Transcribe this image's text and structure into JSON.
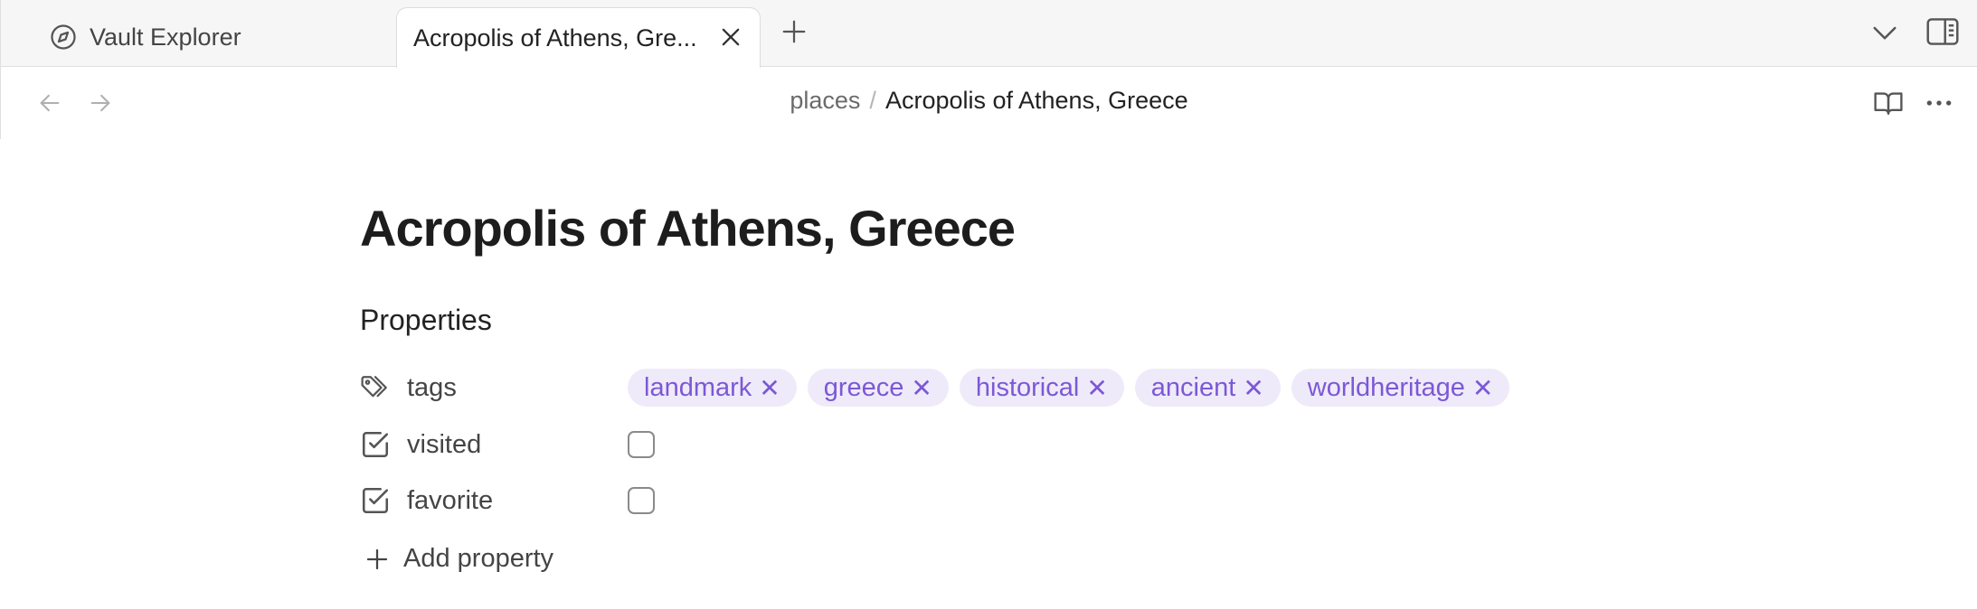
{
  "tabs": [
    {
      "label": "Vault Explorer",
      "icon": "compass-icon",
      "active": false
    },
    {
      "label": "Acropolis of Athens, Gre...",
      "active": true
    }
  ],
  "breadcrumb": {
    "parent": "places",
    "separator": "/",
    "current": "Acropolis of Athens, Greece"
  },
  "note": {
    "title": "Acropolis of Athens, Greece",
    "properties_heading": "Properties",
    "properties": [
      {
        "name": "tags",
        "icon": "tags-icon",
        "type": "tags",
        "tags": [
          "landmark",
          "greece",
          "historical",
          "ancient",
          "worldheritage"
        ]
      },
      {
        "name": "visited",
        "icon": "checkbox-type-icon",
        "type": "checkbox",
        "checked": false
      },
      {
        "name": "favorite",
        "icon": "checkbox-type-icon",
        "type": "checkbox",
        "checked": false
      }
    ],
    "add_property_label": "Add property"
  },
  "colors": {
    "tag_bg": "#efeaf9",
    "tag_text": "#7c58d6",
    "tab_bar_bg": "#f6f6f6"
  }
}
